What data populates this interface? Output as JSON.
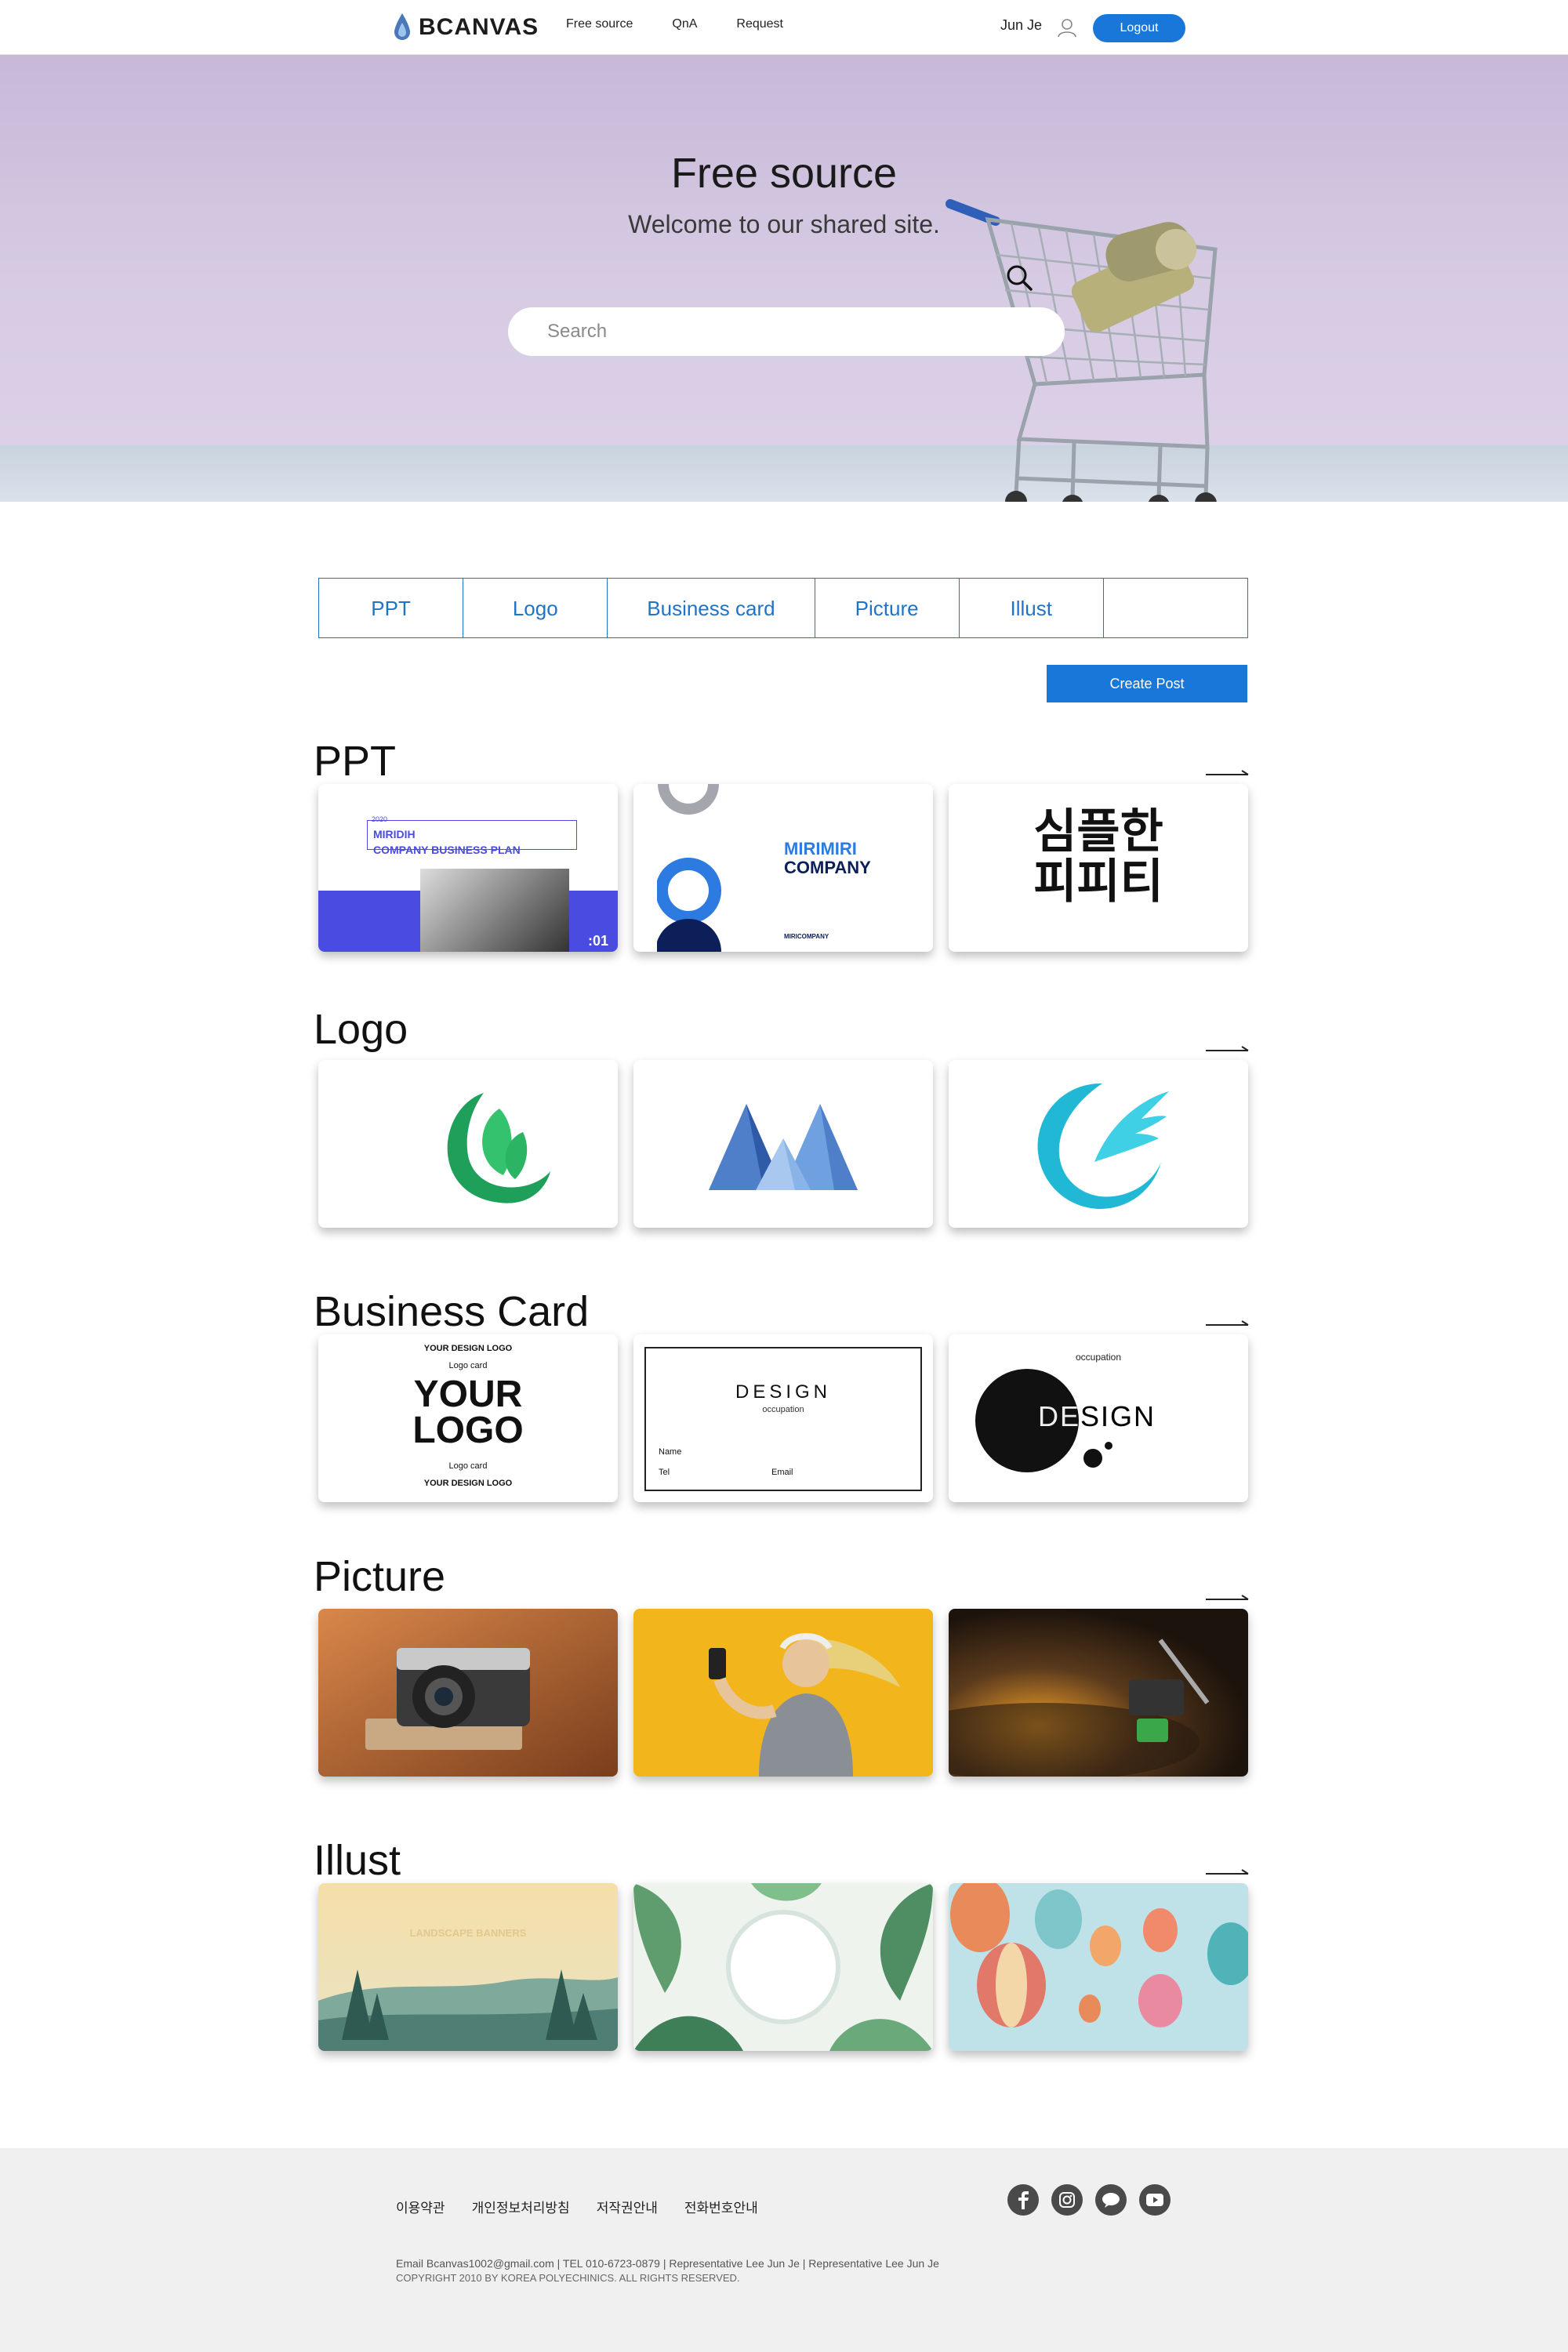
{
  "header": {
    "brand": "BCANVAS",
    "nav": [
      "Free source",
      "QnA",
      "Request"
    ],
    "user_name": "Jun Je",
    "logout_label": "Logout"
  },
  "hero": {
    "title": "Free source",
    "subtitle": "Welcome to our shared site.",
    "search_placeholder": "Search"
  },
  "tabs": [
    {
      "label": "PPT"
    },
    {
      "label": "Logo"
    },
    {
      "label": "Business card"
    },
    {
      "label": "Picture"
    },
    {
      "label": "Illust"
    },
    {
      "label": ""
    }
  ],
  "create_post_label": "Create Post",
  "sections": {
    "ppt": {
      "title": "PPT",
      "cards": [
        {
          "year": "2020",
          "line1": "MIRIDIH",
          "line2": "COMPANY BUSINESS PLAN",
          "page": ":01"
        },
        {
          "line1": "MIRIMIRI",
          "line2": "COMPANY",
          "small": "MIRICOMPANY"
        },
        {
          "line1": "심플한",
          "line2": "피피티"
        }
      ]
    },
    "logo": {
      "title": "Logo"
    },
    "business_card": {
      "title": "Business Card",
      "cards": [
        {
          "arc_top": "YOUR DESIGN LOGO",
          "label_top": "Logo card",
          "big1": "YOUR",
          "big2": "LOGO",
          "label_bottom": "Logo card",
          "arc_bottom": "YOUR DESIGN LOGO"
        },
        {
          "title": "DESIGN",
          "sub": "occupation",
          "name_label": "Name",
          "tel_label": "Tel",
          "email_label": "Email"
        },
        {
          "sub": "occupation",
          "title": "DESIGN"
        }
      ]
    },
    "picture": {
      "title": "Picture"
    },
    "illust": {
      "title": "Illust",
      "cards": [
        {
          "caption": "LANDSCAPE BANNERS"
        }
      ]
    }
  },
  "footer": {
    "links": [
      "이용약관",
      "개인정보처리방침",
      "저작권안내",
      "전화번호안내"
    ],
    "info": "Email Bcanvas1002@gmail.com  |  TEL 010-6723-0879  |  Representative Lee Jun Je  |  Representative Lee Jun Je",
    "copyright": "COPYRIGHT 2010 BY KOREA POLYECHINICS. ALL RIGHTS RESERVED.",
    "social_icons": [
      "facebook-icon",
      "instagram-icon",
      "chat-icon",
      "youtube-icon"
    ]
  },
  "colors": {
    "accent": "#1877d8",
    "tab_border": "#1f73c9",
    "hero_bg": "#d6cbe3",
    "footer_bg": "#f0f0f0"
  }
}
